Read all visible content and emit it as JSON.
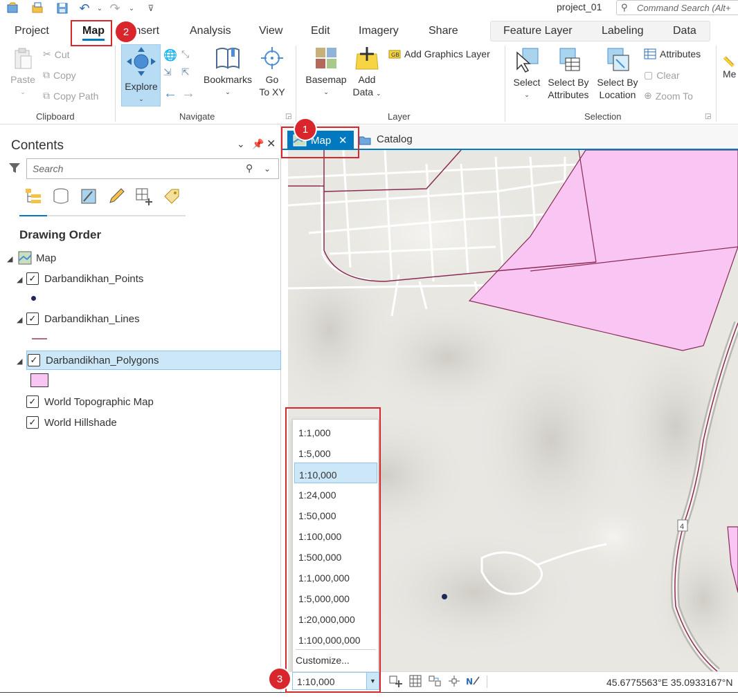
{
  "quick_access": {
    "project_name": "project_01",
    "command_search_placeholder": "Command Search (Alt+"
  },
  "tabs": {
    "project": "Project",
    "map": "Map",
    "insert": "Insert",
    "analysis": "Analysis",
    "view": "View",
    "edit": "Edit",
    "imagery": "Imagery",
    "share": "Share",
    "feature_layer": "Feature Layer",
    "labeling": "Labeling",
    "data": "Data"
  },
  "ribbon": {
    "clipboard": {
      "label": "Clipboard",
      "paste": "Paste",
      "cut": "Cut",
      "copy": "Copy",
      "copy_path": "Copy Path"
    },
    "navigate": {
      "label": "Navigate",
      "explore": "Explore",
      "bookmarks": "Bookmarks",
      "go_to_xy_line1": "Go",
      "go_to_xy_line2": "To XY"
    },
    "layer": {
      "label": "Layer",
      "basemap": "Basemap",
      "add_data_line1": "Add",
      "add_data_line2": "Data",
      "add_graphics_layer": "Add Graphics Layer"
    },
    "selection": {
      "label": "Selection",
      "select": "Select",
      "select_by_attributes_line1": "Select By",
      "select_by_attributes_line2": "Attributes",
      "select_by_location_line1": "Select By",
      "select_by_location_line2": "Location",
      "attributes": "Attributes",
      "clear": "Clear",
      "zoom_to": "Zoom To"
    },
    "cut_off": "Me"
  },
  "contents": {
    "title": "Contents",
    "search_placeholder": "Search",
    "section": "Drawing Order",
    "map_node": "Map",
    "layers": [
      {
        "name": "Darbandikhan_Points",
        "checked": true
      },
      {
        "name": "Darbandikhan_Lines",
        "checked": true
      },
      {
        "name": "Darbandikhan_Polygons",
        "checked": true,
        "selected": true
      },
      {
        "name": "World Topographic Map",
        "checked": true
      },
      {
        "name": "World Hillshade",
        "checked": true
      }
    ]
  },
  "map_tabs": {
    "map": "Map",
    "catalog": "Catalog"
  },
  "map": {
    "road_shield": "4",
    "polygon_color": "#f9c6f3",
    "line_color": "#8a2a55",
    "point_color": "#1f2a5c"
  },
  "scale_dropdown": {
    "options": [
      "1:1,000",
      "1:5,000",
      "1:10,000",
      "1:24,000",
      "1:50,000",
      "1:100,000",
      "1:500,000",
      "1:1,000,000",
      "1:5,000,000",
      "1:20,000,000",
      "1:100,000,000"
    ],
    "selected": "1:10,000",
    "customize": "Customize..."
  },
  "status_bar": {
    "scale_value": "1:10,000",
    "coordinates": "45.6775563°E 35.0933167°N"
  },
  "annotations": {
    "badge_1": "1",
    "badge_2": "2",
    "badge_3": "3",
    "color": "#d9262c"
  }
}
